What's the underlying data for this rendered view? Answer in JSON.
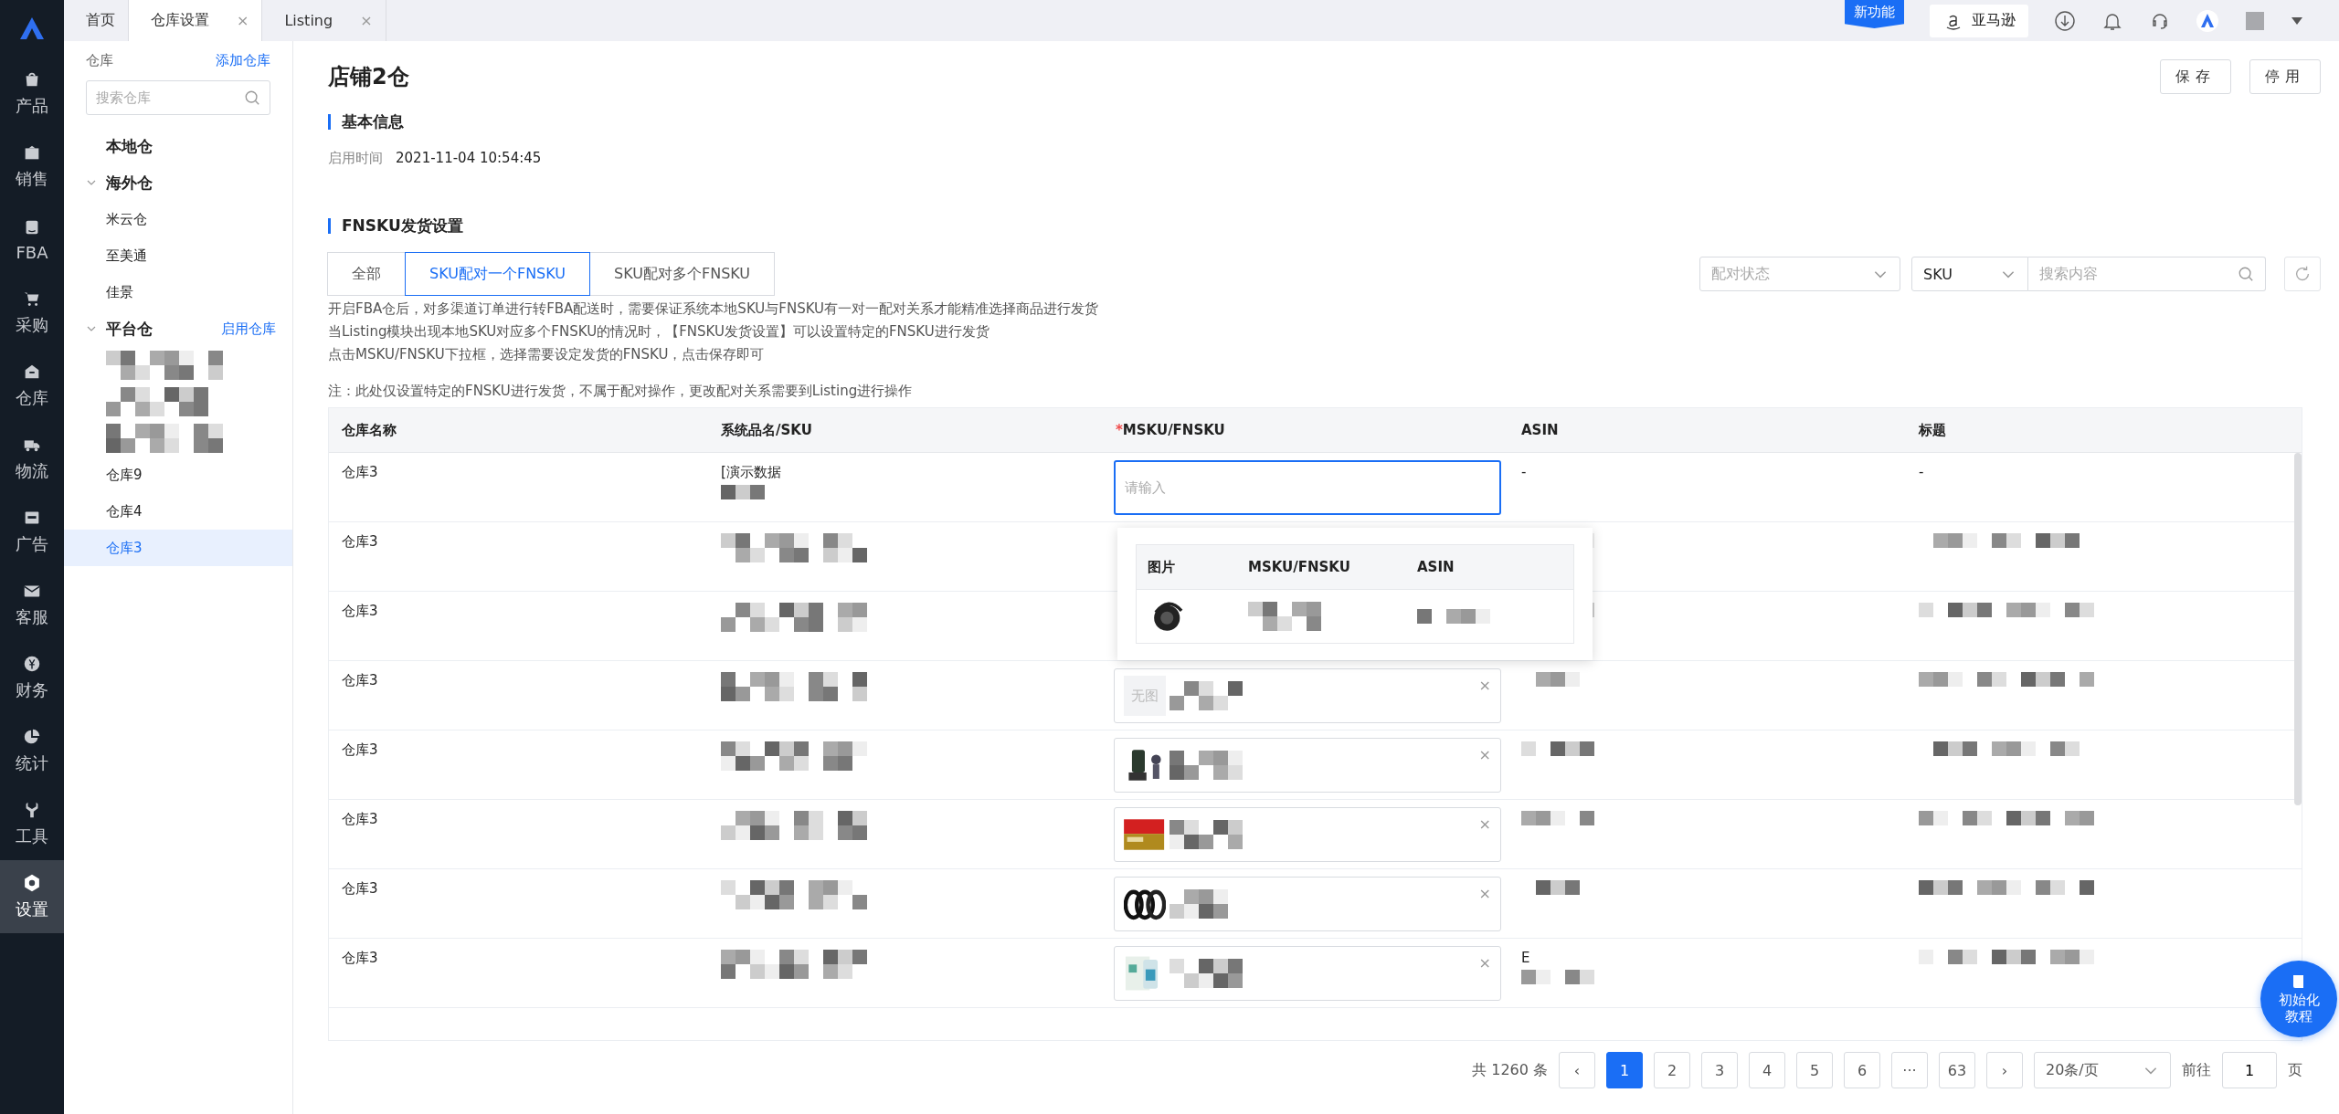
{
  "nav": {
    "items": [
      {
        "label": "产品",
        "selected": false
      },
      {
        "label": "销售",
        "selected": false
      },
      {
        "label": "FBA",
        "selected": false
      },
      {
        "label": "采购",
        "selected": false
      },
      {
        "label": "仓库",
        "selected": false
      },
      {
        "label": "物流",
        "selected": false
      },
      {
        "label": "广告",
        "selected": false
      },
      {
        "label": "客服",
        "selected": false
      },
      {
        "label": "财务",
        "selected": false
      },
      {
        "label": "统计",
        "selected": false
      },
      {
        "label": "工具",
        "selected": false
      },
      {
        "label": "设置",
        "selected": true
      }
    ]
  },
  "tabs": [
    {
      "label": "首页",
      "selected": false
    },
    {
      "label": "仓库设置",
      "selected": true,
      "close": "×"
    },
    {
      "label": "Listing",
      "selected": false,
      "close": "×"
    }
  ],
  "topbar": {
    "badge": "新功能",
    "platform": "亚马逊"
  },
  "warehouse_panel": {
    "title": "仓库",
    "action": "添加仓库",
    "search": {
      "placeholder": "搜索仓库"
    },
    "tree": [
      {
        "label": "本地仓"
      },
      {
        "label": "海外仓",
        "expanded": true,
        "children": [
          {
            "label": "米云仓",
            "selected": false
          },
          {
            "label": "至美通",
            "selected": false
          },
          {
            "label": "佳景",
            "selected": false
          }
        ]
      },
      {
        "label": "平台仓",
        "expanded": true,
        "action": "启用仓库",
        "children": [
          {
            "kind": "pixelated"
          },
          {
            "kind": "pixelated"
          },
          {
            "kind": "pixelated"
          },
          {
            "label": "仓库9",
            "selected": false
          },
          {
            "label": "仓库4",
            "selected": false
          },
          {
            "label": "仓库3",
            "selected": true
          }
        ]
      }
    ]
  },
  "page": {
    "title": "店铺2仓",
    "buttons": [
      "保存",
      "停用"
    ],
    "basic": {
      "heading": "基本信息",
      "label": "启用时间",
      "value": "2021-11-04 10:54:45"
    },
    "fnsku": {
      "heading": "FNSKU发货设置",
      "segments": [
        {
          "label": "全部",
          "selected": false
        },
        {
          "label": "SKU配对一个FNSKU",
          "selected": true
        },
        {
          "label": "SKU配对多个FNSKU",
          "selected": false
        }
      ],
      "filters": {
        "status": {
          "placeholder": "配对状态"
        },
        "field": {
          "value": "SKU"
        },
        "search": {
          "placeholder": "搜索内容"
        }
      },
      "notes": [
        "开启FBA仓后，对多渠道订单进行转FBA配送时，需要保证系统本地SKU与FNSKU有一对一配对关系才能精准选择商品进行发货",
        "当Listing模块出现本地SKU对应多个FNSKU的情况时，【FNSKU发货设置】可以设置特定的FNSKU进行发货",
        "点击MSKU/FNSKU下拉框，选择需要设定发货的FNSKU，点击保存即可"
      ],
      "remark": "注：此处仅设置特定的FNSKU进行发货，不属于配对操作，更改配对关系需要到Listing进行操作"
    }
  },
  "table": {
    "columns": [
      {
        "label": "仓库名称"
      },
      {
        "label": "系统品名/SKU"
      },
      {
        "label": "MSKU/FNSKU",
        "required": "*"
      },
      {
        "label": "ASIN"
      },
      {
        "label": "标题"
      }
    ],
    "rows": [
      {
        "warehouse": "仓库3",
        "sku": "[演示数据",
        "msku": {
          "kind": "input",
          "placeholder": "请输入"
        },
        "asin": "-",
        "title": "-"
      },
      {
        "warehouse": "仓库3",
        "msku": {
          "kind": "hidden"
        }
      },
      {
        "warehouse": "仓库3",
        "msku": {
          "kind": "hidden"
        }
      },
      {
        "warehouse": "仓库3",
        "msku": {
          "kind": "no_image",
          "no_image_text": "无图",
          "close": "×"
        }
      },
      {
        "warehouse": "仓库3",
        "msku": {
          "kind": "picture",
          "close": "×"
        }
      },
      {
        "warehouse": "仓库3",
        "msku": {
          "kind": "picture",
          "close": "×"
        }
      },
      {
        "warehouse": "仓库3",
        "msku": {
          "kind": "picture",
          "close": "×"
        }
      },
      {
        "warehouse": "仓库3",
        "msku": {
          "kind": "picture",
          "close": "×"
        },
        "asin": "E"
      }
    ]
  },
  "dropdown": {
    "columns": [
      "图片",
      "MSKU/FNSKU",
      "ASIN"
    ]
  },
  "pagination": {
    "total": "共 1260 条",
    "prev": "‹",
    "pages": [
      {
        "label": "1",
        "selected": true
      },
      {
        "label": "2",
        "selected": false
      },
      {
        "label": "3",
        "selected": false
      },
      {
        "label": "4",
        "selected": false
      },
      {
        "label": "5",
        "selected": false
      },
      {
        "label": "6",
        "selected": false
      },
      {
        "label": "···",
        "selected": false
      },
      {
        "label": "63",
        "selected": false
      }
    ],
    "next": "›",
    "page_size": "20条/页",
    "goto_label": "前往",
    "goto_value": "1",
    "goto_suffix": "页"
  },
  "help_button": {
    "label": "初始化教程"
  }
}
